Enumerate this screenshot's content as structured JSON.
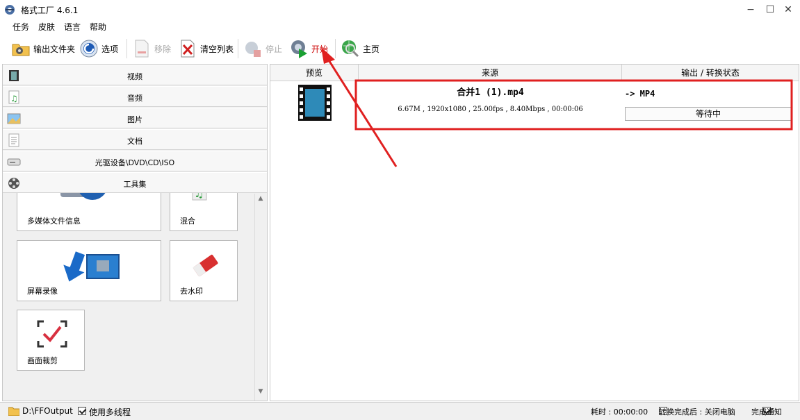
{
  "window": {
    "title": "格式工厂 4.6.1",
    "minimize": "−",
    "maximize": "☐",
    "close": "✕"
  },
  "menu": [
    "任务",
    "皮肤",
    "语言",
    "帮助"
  ],
  "toolbar": {
    "output_folder": "输出文件夹",
    "options": "选项",
    "remove": "移除",
    "clear_list": "清空列表",
    "stop": "停止",
    "start": "开始",
    "home": "主页"
  },
  "categories": [
    {
      "label": "视频",
      "icon": "film-icon"
    },
    {
      "label": "音频",
      "icon": "music-note-icon"
    },
    {
      "label": "图片",
      "icon": "picture-icon"
    },
    {
      "label": "文档",
      "icon": "document-icon"
    },
    {
      "label": "光驱设备\\DVD\\CD\\ISO",
      "icon": "disc-drive-icon"
    },
    {
      "label": "工具集",
      "icon": "film-reel-icon"
    }
  ],
  "tools": {
    "media_info": "多媒体文件信息",
    "mix": "混合",
    "screen_record": "屏幕录像",
    "watermark": "去水印",
    "crop": "画面裁剪"
  },
  "table": {
    "headers": [
      "预览",
      "来源",
      "输出 / 转换状态"
    ],
    "rows": [
      {
        "filename": "合并1 (1).mp4",
        "info": "6.67M , 1920x1080 , 25.00fps , 8.40Mbps , 00:00:06",
        "output": "-> MP4",
        "status": "等待中"
      }
    ]
  },
  "statusbar": {
    "output_path": "D:\\FFOutput",
    "multithread": "使用多线程",
    "multithread_checked": true,
    "elapsed": "耗时 : 00:00:00",
    "after_convert": "转换完成后 : 关闭电脑",
    "after_convert_checked": false,
    "notify": "完成通知",
    "notify_checked": true
  },
  "colors": {
    "highlight_red": "#e02020",
    "start_label": "#cc0000"
  }
}
